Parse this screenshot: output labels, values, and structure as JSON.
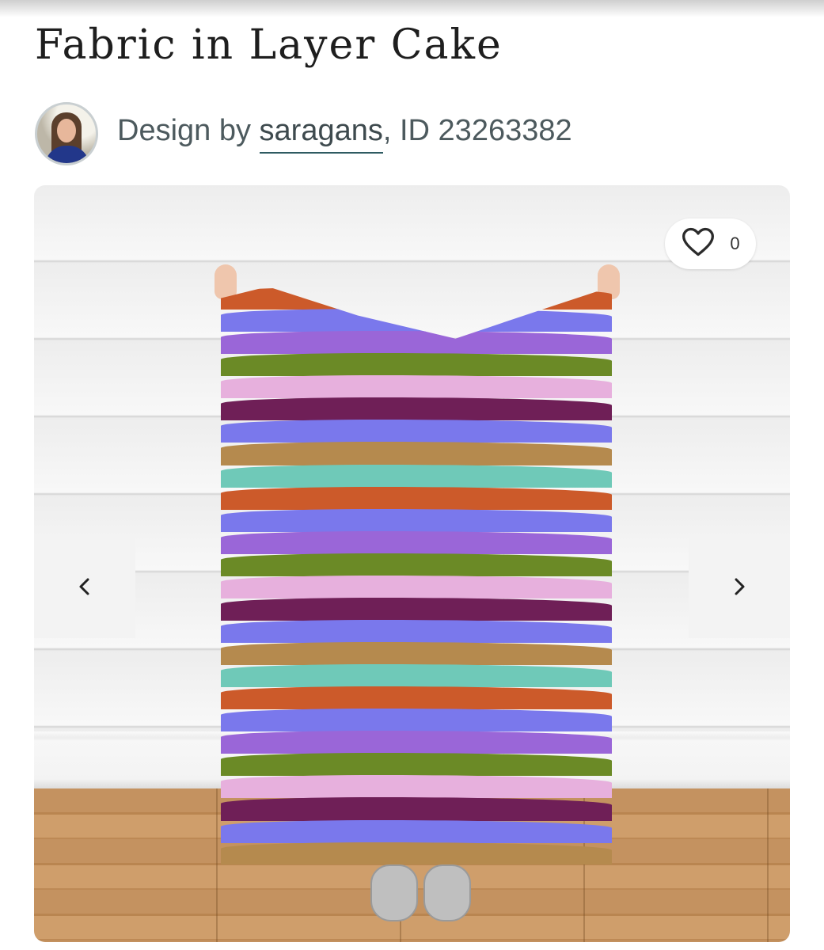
{
  "product": {
    "title": "Fabric in Layer Cake",
    "designer_prefix": "Design by ",
    "designer_name": "saragans",
    "designer_suffix": ", ID 23263382"
  },
  "gallery": {
    "favorite_count": "0",
    "prev_icon": "chevron-left-icon",
    "next_icon": "chevron-right-icon",
    "favorite_icon": "heart-outline-icon",
    "stripe_colors": [
      "#cc5a2a",
      "#7a78ec",
      "#9a66d8",
      "#6b8a26",
      "#e7b0dd",
      "#6f1f57",
      "#7a78ec",
      "#b58a4e",
      "#6fc9b8",
      "#cc5a2a",
      "#7a78ec",
      "#9a66d8",
      "#6b8a26",
      "#e7b0dd",
      "#6f1f57",
      "#7a78ec",
      "#b58a4e",
      "#6fc9b8",
      "#cc5a2a",
      "#7a78ec",
      "#9a66d8",
      "#6b8a26",
      "#e7b0dd",
      "#6f1f57",
      "#7a78ec",
      "#b58a4e"
    ]
  }
}
